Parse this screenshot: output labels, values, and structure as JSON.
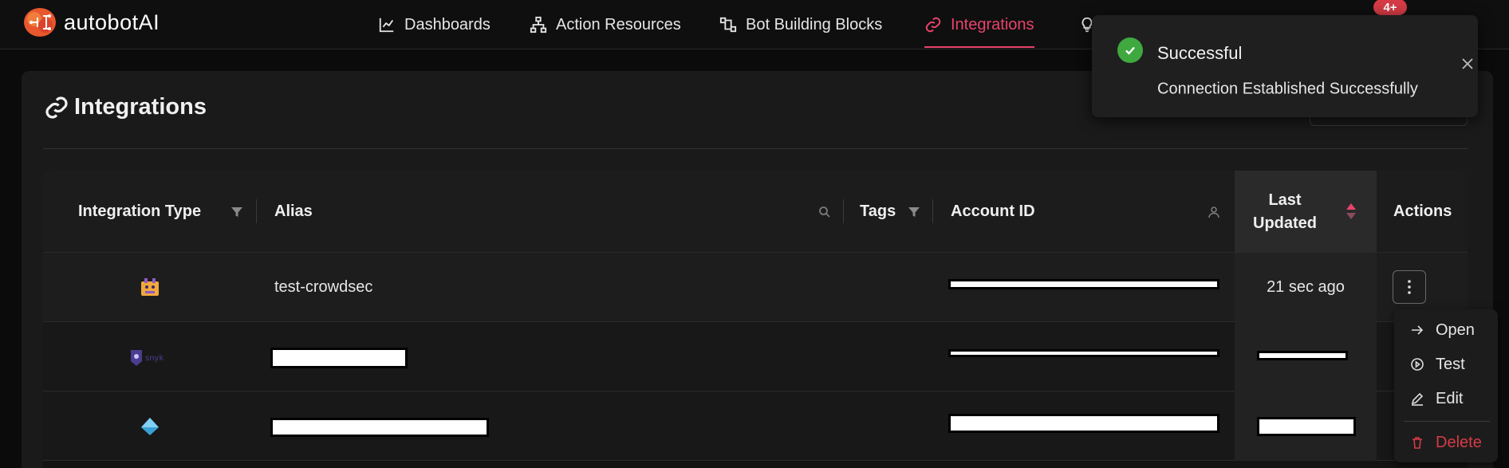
{
  "app": {
    "name": "autobotAI"
  },
  "nav": {
    "items": [
      {
        "label": "Dashboards",
        "icon": "chart-line-icon"
      },
      {
        "label": "Action Resources",
        "icon": "sitemap-icon"
      },
      {
        "label": "Bot Building Blocks",
        "icon": "blocks-icon"
      },
      {
        "label": "Integrations",
        "icon": "link-icon",
        "active": true
      }
    ],
    "notification_count": "4+"
  },
  "page": {
    "title": "Integrations"
  },
  "table": {
    "columns": {
      "integration_type": "Integration Type",
      "alias": "Alias",
      "tags": "Tags",
      "account_id": "Account ID",
      "last_updated_line1": "Last",
      "last_updated_line2": "Updated",
      "actions": "Actions"
    },
    "rows": [
      {
        "alias": "test-crowdsec",
        "last_updated": "21 sec ago",
        "logo": "crowdsec-logo"
      },
      {
        "alias": "",
        "last_updated": "",
        "logo": "snyk-logo"
      },
      {
        "alias": "",
        "last_updated": "",
        "logo": "diamond-logo"
      }
    ]
  },
  "row_menu": {
    "items": [
      {
        "label": "Open",
        "icon": "arrow-right-icon"
      },
      {
        "label": "Test",
        "icon": "play-circle-icon"
      },
      {
        "label": "Edit",
        "icon": "pencil-icon"
      },
      {
        "label": "Delete",
        "icon": "trash-icon",
        "danger": true
      }
    ]
  },
  "toast": {
    "title": "Successful",
    "message": "Connection Established Successfully"
  },
  "colors": {
    "accent": "#e8436c",
    "success": "#3fa83f",
    "danger": "#d63b46"
  }
}
